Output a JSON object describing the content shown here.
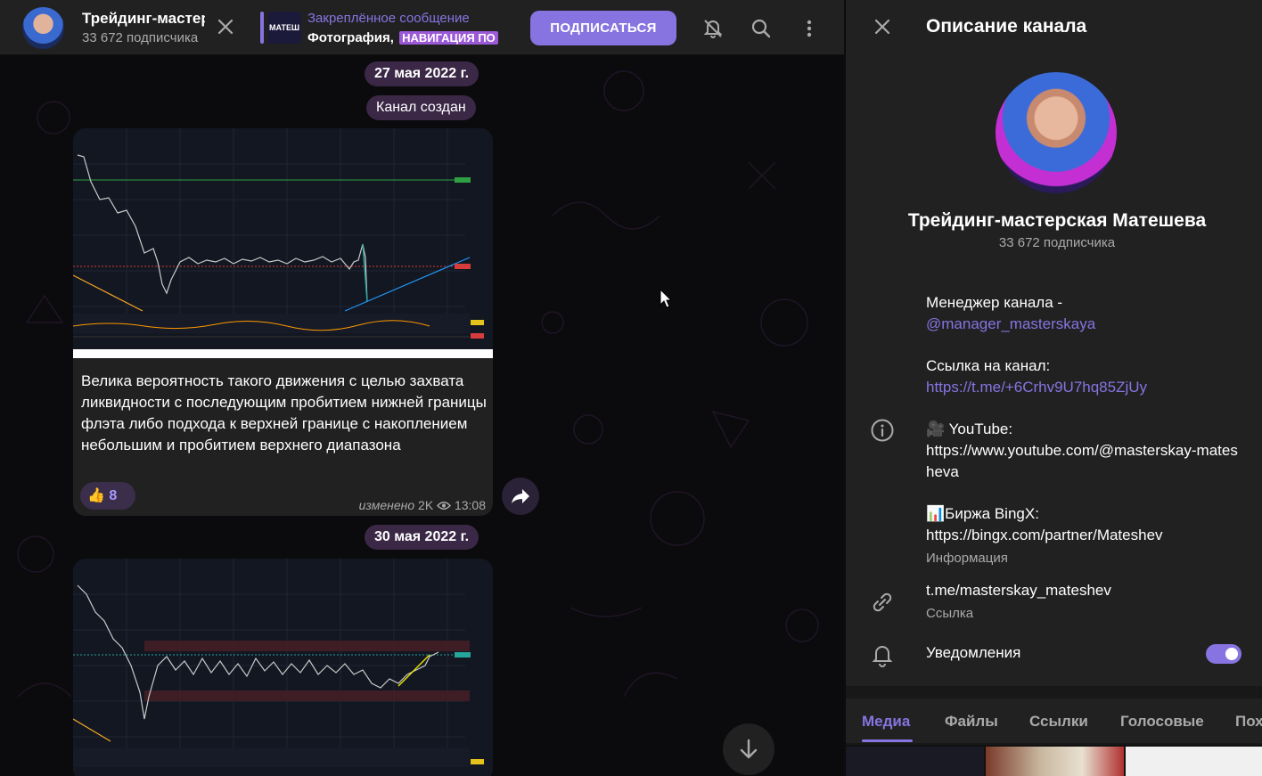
{
  "header": {
    "title": "Трейдинг-мастерская Матешева",
    "subtitle": "33 672 подписчика",
    "pinned_label": "Закреплённое сообщение",
    "pinned_text": "Фотография,",
    "pinned_tag": "НАВИГАЦИЯ ПО",
    "pinned_thumb": "МАТЕШ",
    "subscribe_label": "ПОДПИСАТЬСЯ"
  },
  "chat": {
    "date_1": "27 мая 2022 г.",
    "service_msg": "Канал создан",
    "message_1": {
      "text": "Велика вероятность такого движения с целью захвата ликвидности с последующим пробитием нижней границы флэта либо подхода к верхней границе с накоплением небольшим и пробитием верхнего диапазона",
      "reaction_emoji": "👍",
      "reaction_count": "8",
      "edited": "изменено",
      "views": "2K",
      "time": "13:08"
    },
    "date_2": "30 мая 2022 г."
  },
  "panel": {
    "title": "Описание канала",
    "channel_name": "Трейдинг-мастерская Матешева",
    "subscribers": "33 672 подписчика",
    "desc_line1": "Менеджер канала -",
    "desc_manager": "@manager_masterskaya",
    "desc_line2": "Ссылка на канал:",
    "desc_invite": "https://t.me/+6Crhv9U7hq85ZjUy",
    "desc_line3": "🎥 YouTube:",
    "desc_youtube": "https://www.youtube.com/@masterskay-matesheva",
    "desc_line4": "📊Биржа BingX:",
    "desc_bingx": "https://bingx.com/partner/Mateshev",
    "info_caption": "Информация",
    "username": "t.me/masterskay_mateshev",
    "username_caption": "Ссылка",
    "notifications_label": "Уведомления",
    "notifications_on": true,
    "tabs": [
      "Медиа",
      "Файлы",
      "Ссылки",
      "Голосовые",
      "Пох"
    ]
  },
  "colors": {
    "accent": "#8774e1",
    "bg": "#212121",
    "reaction": "#3a2e4a"
  }
}
